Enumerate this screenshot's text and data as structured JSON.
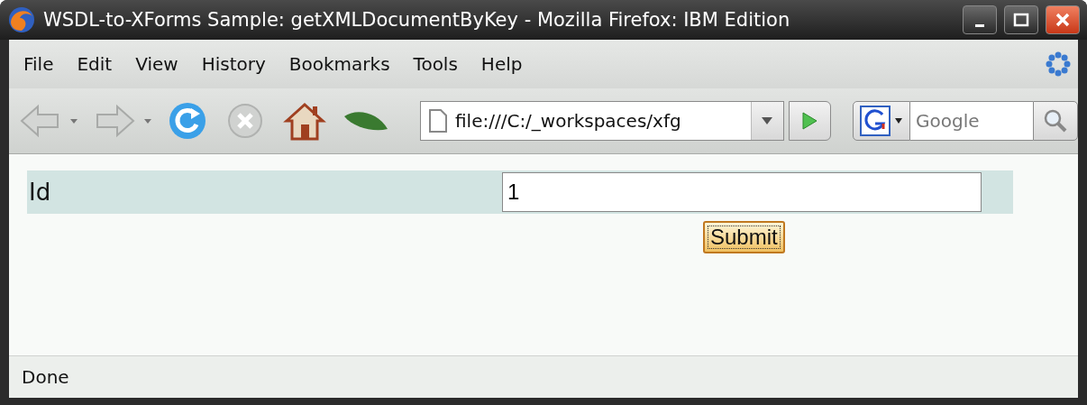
{
  "window": {
    "title": "WSDL-to-XForms Sample: getXMLDocumentByKey - Mozilla Firefox: IBM Edition"
  },
  "menu": [
    "File",
    "Edit",
    "View",
    "History",
    "Bookmarks",
    "Tools",
    "Help"
  ],
  "address_bar": {
    "value": "file:///C:/_workspaces/xfg"
  },
  "search": {
    "placeholder": "Google"
  },
  "form": {
    "label": "Id",
    "value": "1",
    "submit": "Submit"
  },
  "status_bar": {
    "text": "Done"
  }
}
